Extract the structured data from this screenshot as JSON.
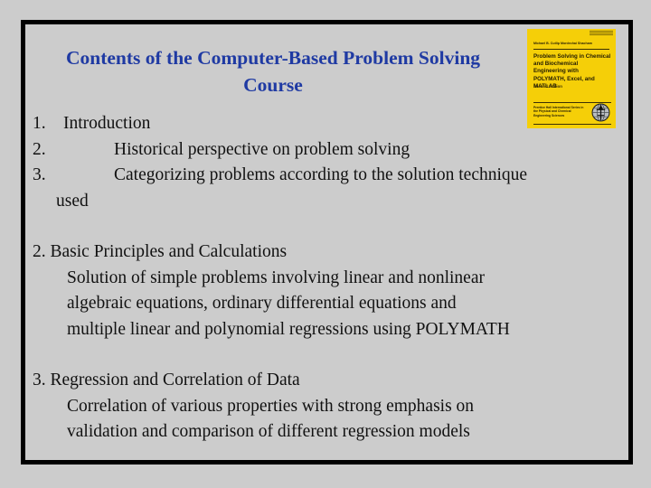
{
  "slide": {
    "background_color": "#cccccc",
    "frame_border_color": "#000000",
    "title_color": "#1f3aa3",
    "title": {
      "line1": "Contents of the Computer-Based Problem Solving",
      "line2": "Course"
    }
  },
  "outline": {
    "section1": {
      "items": [
        {
          "number": "1.",
          "text": "Introduction",
          "level": 1
        },
        {
          "number": "2.",
          "text": "Historical perspective on problem solving",
          "level": 2
        },
        {
          "number": "3.",
          "text": "Categorizing problems according to the solution technique",
          "level": 2
        }
      ],
      "continuation": "used"
    },
    "section2": {
      "heading": "2. Basic Principles and Calculations",
      "body_line1": "Solution of simple problems involving linear and nonlinear",
      "body_line2": "algebraic equations,  ordinary differential equations and",
      "body_line3": "multiple linear and polynomial regressions using POLYMATH"
    },
    "section3": {
      "heading": "3. Regression and Correlation of Data",
      "body_line1": "Correlation of various properties with strong emphasis on",
      "body_line2": "validation and comparison of different regression models"
    }
  },
  "book_cover": {
    "background_color": "#f5cf08",
    "authors": "Michael B. Cutlip   Mordechai Shacham",
    "title": "Problem Solving in Chemical and Biochemical Engineering with POLYMATH, Excel, and MATLAB",
    "edition": "Second Edition",
    "series": "Prentice Hall International Series in the Physical and Chemical Engineering Sciences",
    "logo_name": "publisher-globe-logo"
  }
}
